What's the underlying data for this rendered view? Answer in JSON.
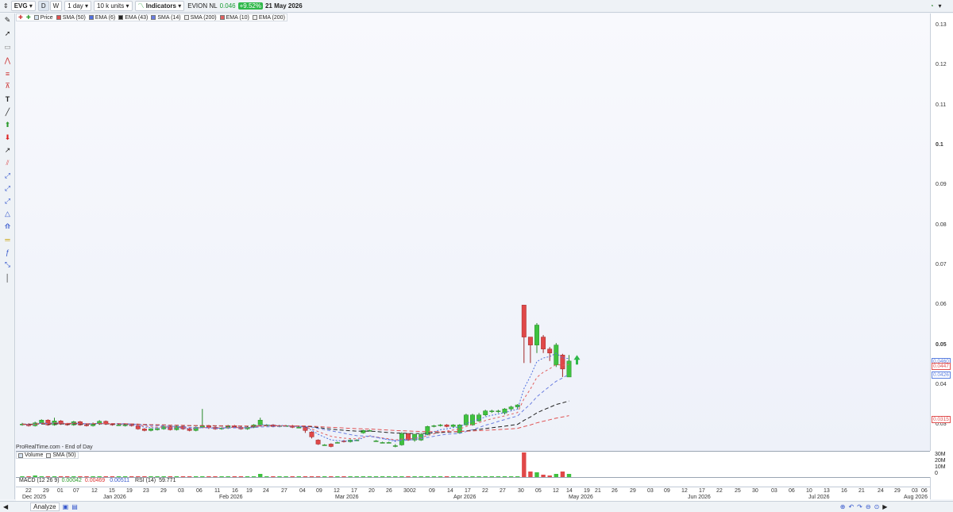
{
  "toolbar": {
    "ticker": "EVG",
    "d_label": "D",
    "w_label": "W",
    "period": "1 day",
    "units": "10 k units",
    "indicators": "Indicators",
    "instrument": "EVION NL",
    "price": "0.046",
    "change": "+9.52%",
    "date": "21 May 2026"
  },
  "legend": {
    "items": [
      {
        "label": "Price",
        "color": "#d7e4f2"
      },
      {
        "label": "SMA (50)",
        "color": "#e05050"
      },
      {
        "label": "EMA (6)",
        "color": "#5070e0"
      },
      {
        "label": "EMA (43)",
        "color": "#222222"
      },
      {
        "label": "SMA (14)",
        "color": "#6a7de0"
      },
      {
        "label": "SMA (200)",
        "color": "#f0f0f0"
      },
      {
        "label": "EMA (10)",
        "color": "#e06060"
      },
      {
        "label": "EMA (200)",
        "color": "#f0f0f0"
      }
    ]
  },
  "price_axis": {
    "labels": [
      "0.13",
      "0.12",
      "0.11",
      "0.1",
      "0.09",
      "0.08",
      "0.07",
      "0.06",
      "0.05",
      "0.04",
      "0.03"
    ],
    "tags": [
      {
        "text": "0.0460",
        "color": "#5b7fe0"
      },
      {
        "text": "0.0447",
        "color": "#e05050"
      },
      {
        "text": "0.0426",
        "color": "#5b7fe0"
      },
      {
        "text": "0.0315",
        "color": "#e05050"
      }
    ]
  },
  "source_label": "ProRealTime.com - End of Day",
  "volume": {
    "legend_volume": "Volume",
    "legend_sma": "SMA (50)",
    "axis_labels": [
      "30M",
      "20M",
      "10M",
      "0"
    ]
  },
  "indicators_row": {
    "macd_label": "MACD (12 26 9)",
    "macd_v1": "0.00042",
    "macd_v2": "0.00469",
    "macd_v3": "0.00511",
    "rsi_label": "RSI (14)",
    "rsi_value": "59.771"
  },
  "time_axis": {
    "days": [
      "22",
      "29",
      "01",
      "07",
      "12",
      "15",
      "19",
      "23",
      "29",
      "03",
      "06",
      "11",
      "16",
      "19",
      "24",
      "27",
      "04",
      "09",
      "12",
      "17",
      "20",
      "26",
      "30",
      "02",
      "09",
      "14",
      "17",
      "22",
      "27",
      "30",
      "05",
      "12",
      "14",
      "19",
      "21",
      "26",
      "29",
      "03",
      "09",
      "12",
      "17",
      "22",
      "25",
      "30",
      "03",
      "06",
      "10",
      "13",
      "16",
      "21",
      "24",
      "29",
      "03",
      "06"
    ],
    "months": [
      "Dec 2025",
      "Jan 2026",
      "Feb 2026",
      "Mar 2026",
      "Apr 2026",
      "May 2026",
      "Jun 2026",
      "Jul 2026",
      "Aug 2026"
    ]
  },
  "bottom": {
    "analyze_label": "Analyze"
  },
  "chart_data": {
    "type": "candlestick",
    "ylim": [
      0.02,
      0.135
    ],
    "y_ticks": [
      0.03,
      0.04,
      0.05,
      0.06,
      0.07,
      0.08,
      0.09,
      0.1,
      0.11,
      0.12,
      0.13
    ],
    "series_note_last_close": 0.046,
    "candles": [
      {
        "o": 0.03,
        "c": 0.0302,
        "h": 0.0305,
        "l": 0.0298
      },
      {
        "o": 0.0302,
        "c": 0.0298,
        "h": 0.0304,
        "l": 0.0296
      },
      {
        "o": 0.0298,
        "c": 0.0305,
        "h": 0.0308,
        "l": 0.0296
      },
      {
        "o": 0.0305,
        "c": 0.0312,
        "h": 0.0314,
        "l": 0.0303
      },
      {
        "o": 0.0312,
        "c": 0.03,
        "h": 0.0314,
        "l": 0.0298
      },
      {
        "o": 0.03,
        "c": 0.031,
        "h": 0.0318,
        "l": 0.0298
      },
      {
        "o": 0.031,
        "c": 0.0302,
        "h": 0.0312,
        "l": 0.03
      },
      {
        "o": 0.0302,
        "c": 0.03,
        "h": 0.0305,
        "l": 0.0298
      },
      {
        "o": 0.03,
        "c": 0.0308,
        "h": 0.031,
        "l": 0.0298
      },
      {
        "o": 0.0308,
        "c": 0.03,
        "h": 0.031,
        "l": 0.0298
      },
      {
        "o": 0.03,
        "c": 0.0298,
        "h": 0.0302,
        "l": 0.0296
      },
      {
        "o": 0.0298,
        "c": 0.0303,
        "h": 0.0306,
        "l": 0.0296
      },
      {
        "o": 0.0303,
        "c": 0.0309,
        "h": 0.0312,
        "l": 0.03
      },
      {
        "o": 0.0309,
        "c": 0.0302,
        "h": 0.0311,
        "l": 0.03
      },
      {
        "o": 0.0302,
        "c": 0.03,
        "h": 0.0304,
        "l": 0.0298
      },
      {
        "o": 0.03,
        "c": 0.03,
        "h": 0.0302,
        "l": 0.0298
      },
      {
        "o": 0.03,
        "c": 0.03,
        "h": 0.0302,
        "l": 0.0296
      },
      {
        "o": 0.03,
        "c": 0.0298,
        "h": 0.0302,
        "l": 0.0296
      },
      {
        "o": 0.0298,
        "c": 0.029,
        "h": 0.03,
        "l": 0.0288
      },
      {
        "o": 0.029,
        "c": 0.0286,
        "h": 0.0292,
        "l": 0.0284
      },
      {
        "o": 0.0286,
        "c": 0.029,
        "h": 0.0292,
        "l": 0.0284
      },
      {
        "o": 0.029,
        "c": 0.029,
        "h": 0.0294,
        "l": 0.0286
      },
      {
        "o": 0.029,
        "c": 0.0296,
        "h": 0.0298,
        "l": 0.0288
      },
      {
        "o": 0.0296,
        "c": 0.0288,
        "h": 0.0298,
        "l": 0.0286
      },
      {
        "o": 0.0288,
        "c": 0.0296,
        "h": 0.0298,
        "l": 0.0286
      },
      {
        "o": 0.0296,
        "c": 0.029,
        "h": 0.0298,
        "l": 0.0288
      },
      {
        "o": 0.029,
        "c": 0.0286,
        "h": 0.0292,
        "l": 0.0284
      },
      {
        "o": 0.0286,
        "c": 0.0294,
        "h": 0.0296,
        "l": 0.0284
      },
      {
        "o": 0.0294,
        "c": 0.0298,
        "h": 0.034,
        "l": 0.0292
      },
      {
        "o": 0.0298,
        "c": 0.0294,
        "h": 0.03,
        "l": 0.029
      },
      {
        "o": 0.0294,
        "c": 0.029,
        "h": 0.0296,
        "l": 0.0288
      },
      {
        "o": 0.029,
        "c": 0.0292,
        "h": 0.0294,
        "l": 0.0288
      },
      {
        "o": 0.0292,
        "c": 0.0298,
        "h": 0.03,
        "l": 0.029
      },
      {
        "o": 0.0298,
        "c": 0.0294,
        "h": 0.03,
        "l": 0.0292
      },
      {
        "o": 0.0294,
        "c": 0.029,
        "h": 0.0296,
        "l": 0.0288
      },
      {
        "o": 0.029,
        "c": 0.0294,
        "h": 0.0296,
        "l": 0.0288
      },
      {
        "o": 0.0294,
        "c": 0.03,
        "h": 0.0302,
        "l": 0.0292
      },
      {
        "o": 0.03,
        "c": 0.0312,
        "h": 0.0318,
        "l": 0.0298
      },
      {
        "o": 0.03,
        "c": 0.03,
        "h": 0.0302,
        "l": 0.0298
      },
      {
        "o": 0.03,
        "c": 0.0296,
        "h": 0.0302,
        "l": 0.0294
      },
      {
        "o": 0.0296,
        "c": 0.0298,
        "h": 0.03,
        "l": 0.0294
      },
      {
        "o": 0.0298,
        "c": 0.0298,
        "h": 0.03,
        "l": 0.0296
      },
      {
        "o": 0.0298,
        "c": 0.0294,
        "h": 0.03,
        "l": 0.0292
      },
      {
        "o": 0.0294,
        "c": 0.0294,
        "h": 0.0296,
        "l": 0.0292
      },
      {
        "o": 0.0294,
        "c": 0.0286,
        "h": 0.0296,
        "l": 0.028
      },
      {
        "o": 0.0282,
        "c": 0.027,
        "h": 0.0284,
        "l": 0.0266
      },
      {
        "o": 0.0262,
        "c": 0.0252,
        "h": 0.0264,
        "l": 0.025
      },
      {
        "o": 0.025,
        "c": 0.025,
        "h": 0.0252,
        "l": 0.0248
      },
      {
        "o": 0.0252,
        "c": 0.0246,
        "h": 0.0254,
        "l": 0.0244
      },
      {
        "o": 0.0256,
        "c": 0.0256,
        "h": 0.0258,
        "l": 0.0254
      },
      {
        "o": 0.026,
        "c": 0.0258,
        "h": 0.0262,
        "l": 0.0256
      },
      {
        "o": 0.0258,
        "c": 0.0262,
        "h": 0.0264,
        "l": 0.0256
      },
      {
        "o": 0.0262,
        "c": 0.0262,
        "h": 0.0264,
        "l": 0.026
      },
      {
        "o": 0.028,
        "c": 0.0286,
        "h": 0.0288,
        "l": 0.0278
      },
      {
        "o": 0.0286,
        "c": 0.0286,
        "h": 0.0288,
        "l": 0.0284
      },
      {
        "o": 0.026,
        "c": 0.026,
        "h": 0.0262,
        "l": 0.0258
      },
      {
        "o": 0.0256,
        "c": 0.0256,
        "h": 0.0258,
        "l": 0.0254
      },
      {
        "o": 0.0256,
        "c": 0.0256,
        "h": 0.0258,
        "l": 0.0254
      },
      {
        "o": 0.0248,
        "c": 0.0248,
        "h": 0.0252,
        "l": 0.0244
      },
      {
        "o": 0.025,
        "c": 0.0278,
        "h": 0.0282,
        "l": 0.0248
      },
      {
        "o": 0.0278,
        "c": 0.0262,
        "h": 0.028,
        "l": 0.026
      },
      {
        "o": 0.0262,
        "c": 0.0276,
        "h": 0.0278,
        "l": 0.0258
      },
      {
        "o": 0.0262,
        "c": 0.0276,
        "h": 0.028,
        "l": 0.026
      },
      {
        "o": 0.0276,
        "c": 0.0296,
        "h": 0.0298,
        "l": 0.0274
      },
      {
        "o": 0.0296,
        "c": 0.0298,
        "h": 0.03,
        "l": 0.0294
      },
      {
        "o": 0.0298,
        "c": 0.03,
        "h": 0.0302,
        "l": 0.0296
      },
      {
        "o": 0.03,
        "c": 0.0296,
        "h": 0.0302,
        "l": 0.0294
      },
      {
        "o": 0.0296,
        "c": 0.03,
        "h": 0.0302,
        "l": 0.0294
      },
      {
        "o": 0.028,
        "c": 0.03,
        "h": 0.0302,
        "l": 0.0278
      },
      {
        "o": 0.03,
        "c": 0.0325,
        "h": 0.0328,
        "l": 0.0298
      },
      {
        "o": 0.03,
        "c": 0.0325,
        "h": 0.0328,
        "l": 0.0298
      },
      {
        "o": 0.031,
        "c": 0.0325,
        "h": 0.033,
        "l": 0.0308
      },
      {
        "o": 0.0325,
        "c": 0.0335,
        "h": 0.0338,
        "l": 0.0322
      },
      {
        "o": 0.0335,
        "c": 0.0335,
        "h": 0.0338,
        "l": 0.033
      },
      {
        "o": 0.0335,
        "c": 0.0335,
        "h": 0.0338,
        "l": 0.033
      },
      {
        "o": 0.033,
        "c": 0.034,
        "h": 0.0342,
        "l": 0.0326
      },
      {
        "o": 0.034,
        "c": 0.0345,
        "h": 0.0348,
        "l": 0.0336
      },
      {
        "o": 0.0345,
        "c": 0.035,
        "h": 0.0352,
        "l": 0.034
      },
      {
        "o": 0.06,
        "c": 0.052,
        "h": 0.06,
        "l": 0.0455
      },
      {
        "o": 0.052,
        "c": 0.05,
        "h": 0.052,
        "l": 0.0455
      },
      {
        "o": 0.05,
        "c": 0.055,
        "h": 0.0555,
        "l": 0.048
      },
      {
        "o": 0.052,
        "c": 0.049,
        "h": 0.0525,
        "l": 0.048
      },
      {
        "o": 0.049,
        "c": 0.048,
        "h": 0.0495,
        "l": 0.046
      },
      {
        "o": 0.045,
        "c": 0.05,
        "h": 0.0505,
        "l": 0.0445
      },
      {
        "o": 0.0475,
        "c": 0.044,
        "h": 0.0478,
        "l": 0.042
      },
      {
        "o": 0.042,
        "c": 0.046,
        "h": 0.0475,
        "l": 0.042
      }
    ],
    "volume_max_label": "30M"
  }
}
